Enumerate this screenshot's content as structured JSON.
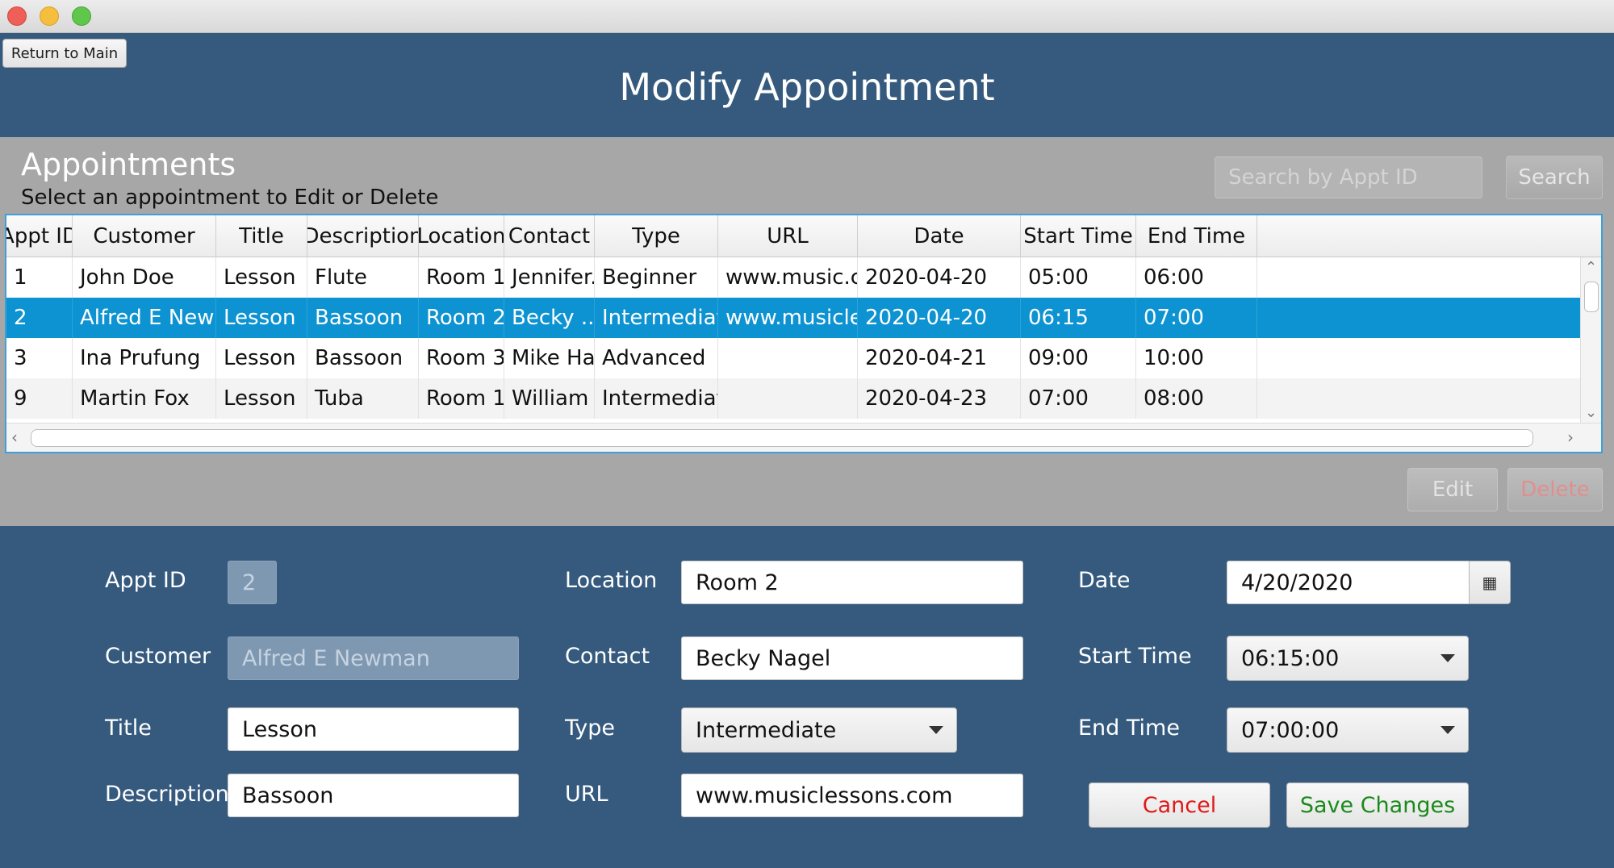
{
  "window": {
    "controls": [
      "close",
      "minimize",
      "zoom"
    ]
  },
  "header": {
    "return_label": "Return to Main",
    "title": "Modify Appointment"
  },
  "panel": {
    "title": "Appointments",
    "subtitle": "Select an appointment to Edit or Delete",
    "search_placeholder": "Search by Appt ID",
    "search_label": "Search",
    "edit_label": "Edit",
    "delete_label": "Delete"
  },
  "table": {
    "columns": [
      "Appt ID",
      "Customer",
      "Title",
      "Description",
      "Location",
      "Contact",
      "Type",
      "URL",
      "Date",
      "Start Time",
      "End Time"
    ],
    "rows": [
      [
        "1",
        "John Doe",
        "Lesson",
        "Flute",
        "Room 1",
        "Jennifer...",
        "Beginner",
        "www.music.com",
        "2020-04-20",
        "05:00",
        "06:00"
      ],
      [
        "2",
        "Alfred E Newman",
        "Lesson",
        "Bassoon",
        "Room 2",
        "Becky ...",
        "Intermediate",
        "www.musicles...",
        "2020-04-20",
        "06:15",
        "07:00"
      ],
      [
        "3",
        "Ina Prufung",
        "Lesson",
        "Bassoon",
        "Room 3",
        "Mike Ha...",
        "Advanced",
        "",
        "2020-04-21",
        "09:00",
        "10:00"
      ],
      [
        "9",
        "Martin Fox",
        "Lesson",
        "Tuba",
        "Room 1...",
        "William ...",
        "Intermediate",
        "",
        "2020-04-23",
        "07:00",
        "08:00"
      ]
    ],
    "selected_row_index": 1
  },
  "form": {
    "appt_id_label": "Appt ID",
    "appt_id_value": "2",
    "customer_label": "Customer",
    "customer_value": "Alfred E Newman",
    "title_label": "Title",
    "title_value": "Lesson",
    "description_label": "Description",
    "description_value": "Bassoon",
    "location_label": "Location",
    "location_value": "Room 2",
    "contact_label": "Contact",
    "contact_value": "Becky Nagel",
    "type_label": "Type",
    "type_value": "Intermediate",
    "url_label": "URL",
    "url_value": "www.musiclessons.com",
    "date_label": "Date",
    "date_value": "4/20/2020",
    "start_label": "Start Time",
    "start_value": "06:15:00",
    "end_label": "End Time",
    "end_value": "07:00:00",
    "cancel_label": "Cancel",
    "save_label": "Save Changes"
  },
  "icons": {
    "calendar": "calendar-icon",
    "caret": "chevron-down-icon"
  },
  "colors": {
    "background": "#355a7e",
    "panel": "#a7a7a7",
    "selection": "#0d93d2",
    "cancel": "#e01919",
    "save": "#1b8a1b"
  }
}
